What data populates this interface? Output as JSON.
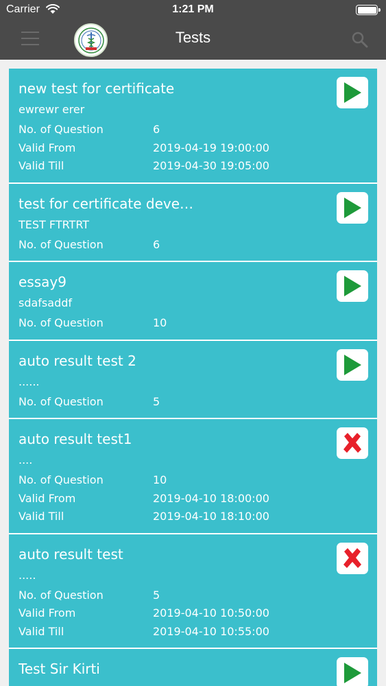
{
  "status_bar": {
    "carrier": "Carrier",
    "time": "1:21 PM"
  },
  "nav": {
    "title": "Tests",
    "menu_icon": "hamburger-menu-icon",
    "search_icon": "search-icon",
    "logo_icon": "caduceus-logo-icon"
  },
  "colors": {
    "card_bg": "#3bbfcc",
    "nav_bg": "#4a4a4a",
    "play_green": "#1e9a3a",
    "close_red": "#e8202a"
  },
  "tests": [
    {
      "name": "new test for certificate",
      "description": "ewrewr erer",
      "question_label": "No. of Question",
      "question_count": "6",
      "valid_from_label": "Valid From",
      "valid_from": "2019-04-19 19:00:00",
      "valid_till_label": "Valid Till",
      "valid_till": "2019-04-30 19:05:00",
      "action": "play"
    },
    {
      "name": "test for certificate deve…",
      "description": "TEST FTRTRT",
      "question_label": "No. of Question",
      "question_count": "6",
      "action": "play"
    },
    {
      "name": "essay9",
      "description": "sdafsaddf",
      "question_label": "No. of Question",
      "question_count": "10",
      "action": "play"
    },
    {
      "name": "auto result test 2",
      "description": "......",
      "question_label": "No. of Question",
      "question_count": "5",
      "action": "play"
    },
    {
      "name": "auto result test1",
      "description": "....",
      "question_label": "No. of Question",
      "question_count": "10",
      "valid_from_label": "Valid From",
      "valid_from": "2019-04-10 18:00:00",
      "valid_till_label": "Valid Till",
      "valid_till": "2019-04-10 18:10:00",
      "action": "closed"
    },
    {
      "name": "auto result test",
      "description": ".....",
      "question_label": "No. of Question",
      "question_count": "5",
      "valid_from_label": "Valid From",
      "valid_from": "2019-04-10 10:50:00",
      "valid_till_label": "Valid Till",
      "valid_till": "2019-04-10 10:55:00",
      "action": "closed"
    },
    {
      "name": "Test Sir Kirti",
      "action": "play"
    }
  ]
}
